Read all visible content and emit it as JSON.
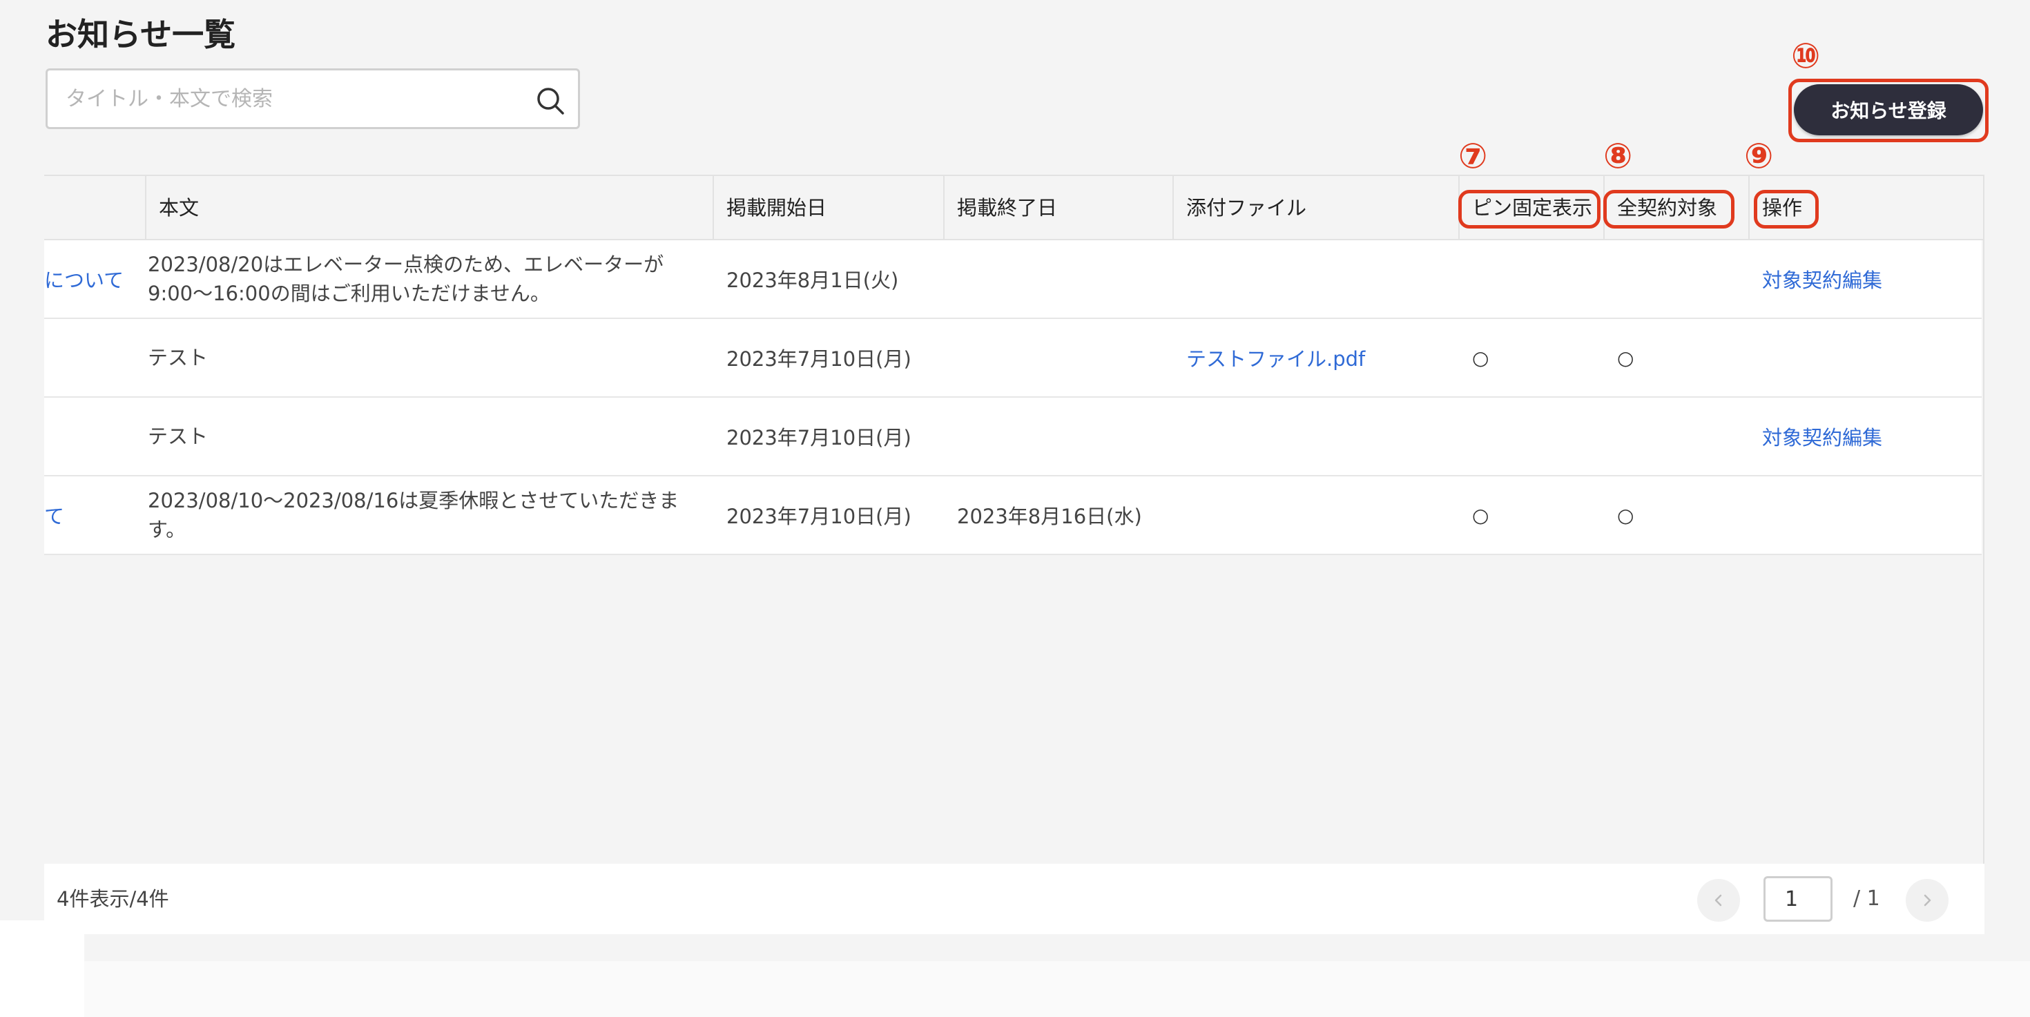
{
  "page": {
    "title": "お知らせ一覧"
  },
  "search": {
    "placeholder": "タイトル・本文で検索",
    "value": ""
  },
  "annotations": {
    "pin": "⑦",
    "all_contracts": "⑧",
    "operation": "⑨",
    "register": "⑩",
    "color": "#e03a1e"
  },
  "toolbar": {
    "register_label": "お知らせ登録"
  },
  "table": {
    "headers": {
      "body": "本文",
      "start": "掲載開始日",
      "end": "掲載終了日",
      "attachment": "添付ファイル",
      "pin": "ピン固定表示",
      "all_contracts": "全契約対象",
      "operation": "操作"
    },
    "rows": [
      {
        "title_partial": "について",
        "body": "2023/08/20はエレベーター点検のため、エレベーターが 9:00〜16:00の間はご利用いただけません。",
        "start": "2023年8月1日(火)",
        "end": "",
        "attachment": "",
        "pin": "",
        "all_contracts": "",
        "operation": "対象契約編集"
      },
      {
        "title_partial": "",
        "body": "テスト",
        "start": "2023年7月10日(月)",
        "end": "",
        "attachment": "テストファイル.pdf",
        "pin": "○",
        "all_contracts": "○",
        "operation": ""
      },
      {
        "title_partial": "",
        "body": "テスト",
        "start": "2023年7月10日(月)",
        "end": "",
        "attachment": "",
        "pin": "",
        "all_contracts": "",
        "operation": "対象契約編集"
      },
      {
        "title_partial": "て",
        "body": "2023/08/10〜2023/08/16は夏季休暇とさせていただきます。",
        "start": "2023年7月10日(月)",
        "end": "2023年8月16日(水)",
        "attachment": "",
        "pin": "○",
        "all_contracts": "○",
        "operation": ""
      }
    ]
  },
  "pagination": {
    "count_label": "4件表示/4件",
    "current_page": "1",
    "total_label": "/ 1"
  },
  "colors": {
    "background": "#f4f4f4",
    "link": "#2f6ad6",
    "button_dark": "#2e2e3c",
    "annotation_red": "#e03a1e"
  }
}
